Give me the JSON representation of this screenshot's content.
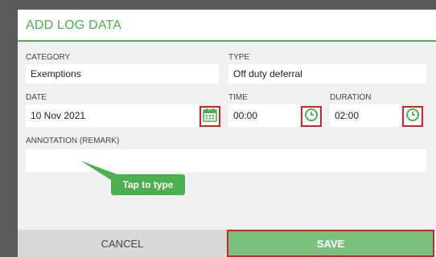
{
  "dialog": {
    "title": "ADD LOG DATA"
  },
  "fields": {
    "category_label": "CATEGORY",
    "category_value": "Exemptions",
    "type_label": "TYPE",
    "type_value": "Off duty deferral",
    "date_label": "DATE",
    "date_value": "10 Nov 2021",
    "time_label": "TIME",
    "time_value": "00:00",
    "duration_label": "DURATION",
    "duration_value": "02:00",
    "annotation_label": "ANNOTATION (REMARK)",
    "annotation_value": ""
  },
  "callout": {
    "text": "Tap to type"
  },
  "buttons": {
    "cancel": "CANCEL",
    "save": "SAVE"
  },
  "icons": {
    "calendar": "calendar-icon",
    "clock": "clock-icon"
  },
  "colors": {
    "accent": "#4caf50",
    "highlight": "#c62828"
  }
}
